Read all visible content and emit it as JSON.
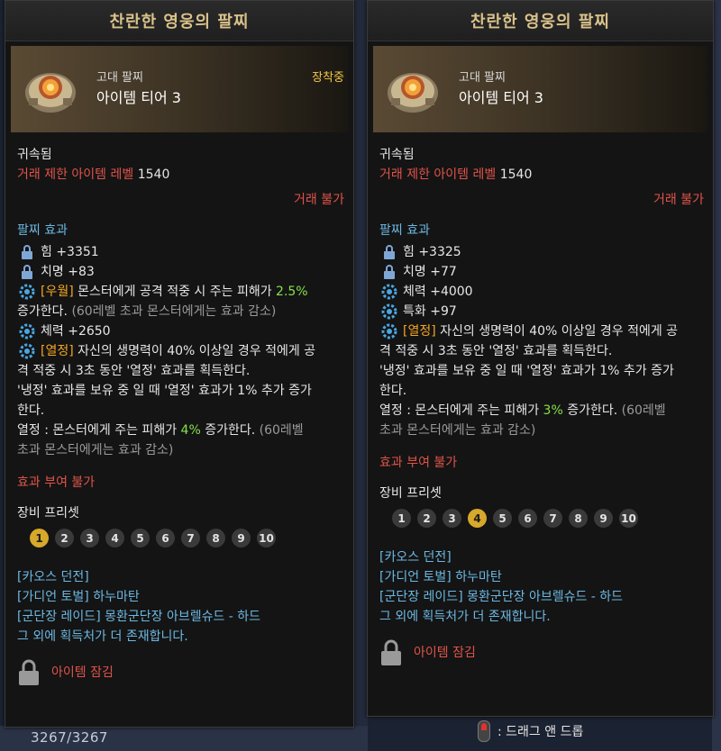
{
  "background": {
    "number_text": "3267/3267",
    "drag_hint": ": 드래그 앤 드롭"
  },
  "left": {
    "title": "찬란한 영웅의 팔찌",
    "grade": "고대 팔찌",
    "tier": "아이템 티어 3",
    "equipped": "장착중",
    "bound": "귀속됨",
    "trade_limit_label": "거래 제한 아이템 레벨",
    "trade_limit_value": "1540",
    "trade_status": "거래 불가",
    "effects_header": "팔찌 효과",
    "stat1": "힘 +3351",
    "stat2": "치명 +83",
    "special1_tag": "[우월]",
    "special1_text": "몬스터에게 공격 적중 시 주는 피해가",
    "special1_value": "2.5%",
    "special1_line2": "증가한다.",
    "special1_note": "(60레벨 초과 몬스터에게는 효과 감소)",
    "stat3": "체력 +2650",
    "special2_tag": "[열정]",
    "special2_text1": "자신의 생명력이 40% 이상일 경우 적에게 공",
    "special2_text2": "격 적중 시 3초 동안 '열정' 효과를 획득한다.",
    "special2_text3": "'냉정' 효과를 보유 중 일 때 '열정' 효과가 1% 추가 증가",
    "special2_text4": "한다.",
    "special2_text5": "열정 : 몬스터에게 주는 피해가",
    "special2_value": "4%",
    "special2_text6": "증가한다.",
    "special2_note1": "(60레벨",
    "special2_note2": "초과 몬스터에게는 효과 감소)",
    "no_effect": "효과 부여 불가",
    "preset_label": "장비 프리셋",
    "presets": [
      "1",
      "2",
      "3",
      "4",
      "5",
      "6",
      "7",
      "8",
      "9",
      "10"
    ],
    "preset_active_index": 0,
    "sources": [
      "[카오스 던전]",
      "[가디언 토벌] 하누마탄",
      "[군단장 레이드] 몽환군단장 아브렐슈드 - 하드"
    ],
    "more_sources": "그 외에 획득처가 더 존재합니다.",
    "lock_text": "아이템 잠김"
  },
  "right": {
    "title": "찬란한 영웅의 팔찌",
    "grade": "고대 팔찌",
    "tier": "아이템 티어 3",
    "bound": "귀속됨",
    "trade_limit_label": "거래 제한 아이템 레벨",
    "trade_limit_value": "1540",
    "trade_status": "거래 불가",
    "effects_header": "팔찌 효과",
    "stat1": "힘 +3325",
    "stat2": "치명 +77",
    "stat3": "체력 +4000",
    "stat4": "특화 +97",
    "special_tag": "[열정]",
    "special_text1": "자신의 생명력이 40% 이상일 경우 적에게 공",
    "special_text2": "격 적중 시 3초 동안 '열정' 효과를 획득한다.",
    "special_text3": "'냉정' 효과를 보유 중 일 때 '열정' 효과가 1% 추가 증가",
    "special_text4": "한다.",
    "special_text5": "열정 : 몬스터에게 주는 피해가",
    "special_value": "3%",
    "special_text6": "증가한다.",
    "special_note1": "(60레벨",
    "special_note2": "초과 몬스터에게는 효과 감소)",
    "no_effect": "효과 부여 불가",
    "preset_label": "장비 프리셋",
    "presets": [
      "1",
      "2",
      "3",
      "4",
      "5",
      "6",
      "7",
      "8",
      "9",
      "10"
    ],
    "preset_active_index": 3,
    "sources": [
      "[카오스 던전]",
      "[가디언 토벌] 하누마탄",
      "[군단장 레이드] 몽환군단장 아브렐슈드 - 하드"
    ],
    "more_sources": "그 외에 획득처가 더 존재합니다.",
    "lock_text": "아이템 잠김"
  },
  "colors": {
    "title": "#d9c18a",
    "red": "#e0534a",
    "blue": "#6cb8e2",
    "green": "#86e24a",
    "gold": "#d6a82b"
  }
}
